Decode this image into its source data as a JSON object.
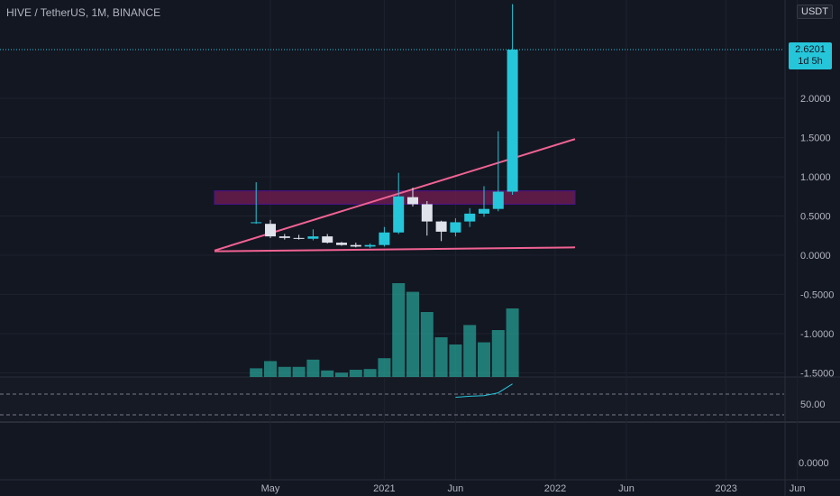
{
  "header": {
    "title": "HIVE / TetherUS, 1M, BINANCE",
    "currency": "USDT"
  },
  "price_label": {
    "value": "2.6201",
    "countdown": "1d 5h"
  },
  "colors": {
    "background": "#131722",
    "up": "#26c6da",
    "down": "#e0e3eb",
    "volume": "#26a69a",
    "trendline": "#f06292",
    "zone": "#6a1b4d",
    "rsi_line": "#26c6da"
  },
  "chart_data": {
    "type": "candlestick",
    "y_axis_ticks": [
      "2.0000",
      "1.5000",
      "1.0000",
      "0.5000",
      "0.0000",
      "-0.5000",
      "-1.0000",
      "-1.5000"
    ],
    "y_range": [
      -1.5,
      3.0
    ],
    "x_axis_ticks": [
      {
        "label": "May",
        "date": "2020-05"
      },
      {
        "label": "2021",
        "date": "2021-01"
      },
      {
        "label": "Jun",
        "date": "2021-06"
      },
      {
        "label": "2022",
        "date": "2022-01"
      },
      {
        "label": "Jun",
        "date": "2022-06"
      },
      {
        "label": "2023",
        "date": "2023-01"
      },
      {
        "label": "Jun",
        "date": "2023-06"
      }
    ],
    "candles": [
      {
        "date": "2020-04",
        "open": 0.42,
        "high": 0.93,
        "low": 0.4,
        "close": 0.42
      },
      {
        "date": "2020-05",
        "open": 0.4,
        "high": 0.45,
        "low": 0.22,
        "close": 0.24
      },
      {
        "date": "2020-06",
        "open": 0.24,
        "high": 0.27,
        "low": 0.2,
        "close": 0.22
      },
      {
        "date": "2020-07",
        "open": 0.22,
        "high": 0.26,
        "low": 0.2,
        "close": 0.21
      },
      {
        "date": "2020-08",
        "open": 0.21,
        "high": 0.33,
        "low": 0.19,
        "close": 0.24
      },
      {
        "date": "2020-09",
        "open": 0.24,
        "high": 0.27,
        "low": 0.15,
        "close": 0.16
      },
      {
        "date": "2020-10",
        "open": 0.16,
        "high": 0.17,
        "low": 0.12,
        "close": 0.13
      },
      {
        "date": "2020-11",
        "open": 0.13,
        "high": 0.16,
        "low": 0.1,
        "close": 0.11
      },
      {
        "date": "2020-12",
        "open": 0.11,
        "high": 0.15,
        "low": 0.09,
        "close": 0.13
      },
      {
        "date": "2021-01",
        "open": 0.13,
        "high": 0.36,
        "low": 0.11,
        "close": 0.29
      },
      {
        "date": "2021-02",
        "open": 0.29,
        "high": 1.05,
        "low": 0.27,
        "close": 0.75
      },
      {
        "date": "2021-03",
        "open": 0.74,
        "high": 0.86,
        "low": 0.62,
        "close": 0.65
      },
      {
        "date": "2021-04",
        "open": 0.65,
        "high": 0.69,
        "low": 0.25,
        "close": 0.43
      },
      {
        "date": "2021-05",
        "open": 0.43,
        "high": 0.44,
        "low": 0.18,
        "close": 0.3
      },
      {
        "date": "2021-06",
        "open": 0.29,
        "high": 0.47,
        "low": 0.24,
        "close": 0.42
      },
      {
        "date": "2021-07",
        "open": 0.43,
        "high": 0.6,
        "low": 0.36,
        "close": 0.53
      },
      {
        "date": "2021-08",
        "open": 0.53,
        "high": 0.88,
        "low": 0.49,
        "close": 0.59
      },
      {
        "date": "2021-09",
        "open": 0.59,
        "high": 1.58,
        "low": 0.56,
        "close": 0.81
      },
      {
        "date": "2021-10",
        "open": 0.81,
        "high": 3.2,
        "low": 0.77,
        "close": 2.62
      }
    ],
    "volume": [
      0.12,
      0.22,
      0.14,
      0.14,
      0.24,
      0.09,
      0.06,
      0.1,
      0.11,
      0.26,
      1.3,
      1.18,
      0.9,
      0.55,
      0.45,
      0.72,
      0.48,
      0.65,
      0.95
    ],
    "rsi": {
      "ticks": [
        "50.00"
      ],
      "values": [
        null,
        null,
        null,
        null,
        null,
        null,
        null,
        null,
        null,
        null,
        null,
        null,
        null,
        null,
        62,
        64,
        65,
        70,
        86
      ]
    },
    "lower_pane": {
      "ticks": [
        "0.0000"
      ]
    },
    "drawings": [
      {
        "type": "trendline",
        "from": {
          "date": "2020-01",
          "price": 0.06
        },
        "to": {
          "date": "2021-11",
          "price": 1.48
        }
      },
      {
        "type": "trendline",
        "from": {
          "date": "2020-01",
          "price": 0.05
        },
        "to": {
          "date": "2021-11",
          "price": 0.1
        }
      },
      {
        "type": "zone",
        "from_date": "2020-01",
        "to_date": "2021-11",
        "top": 0.82,
        "bottom": 0.65
      }
    ]
  }
}
